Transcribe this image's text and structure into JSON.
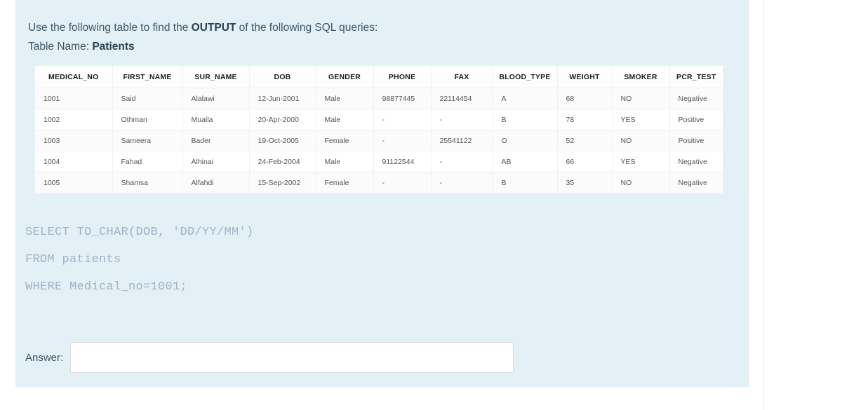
{
  "prompt": {
    "line1_before": "Use the following table to find the ",
    "line1_bold": "OUTPUT",
    "line1_after": " of the following SQL queries:",
    "line2_before": "Table Name: ",
    "line2_bold": "Patients"
  },
  "table": {
    "name": "Patients",
    "columns": [
      "MEDICAL_NO",
      "FIRST_NAME",
      "SUR_NAME",
      "DOB",
      "GENDER",
      "PHONE",
      "FAX",
      "BLOOD_TYPE",
      "WEIGHT",
      "SMOKER",
      "PCR_TEST"
    ],
    "rows": [
      [
        "1001",
        "Said",
        "Alalawi",
        "12-Jun-2001",
        "Male",
        "98877445",
        "22114454",
        "A",
        "68",
        "NO",
        "Negative"
      ],
      [
        "1002",
        "Othman",
        "Mualla",
        "20-Apr-2000",
        "Male",
        "-",
        "-",
        "B",
        "78",
        "YES",
        "Positive"
      ],
      [
        "1003",
        "Sameera",
        "Bader",
        "19-Oct-2005",
        "Female",
        "-",
        "25541122",
        "O",
        "52",
        "NO",
        "Positive"
      ],
      [
        "1004",
        "Fahad",
        "Alhinai",
        "24-Feb-2004",
        "Male",
        "91122544",
        "-",
        "AB",
        "66",
        "YES",
        "Negative"
      ],
      [
        "1005",
        "Shamsa",
        "Alfahdi",
        "15-Sep-2002",
        "Female",
        "-",
        "-",
        "B",
        "35",
        "NO",
        "Negative"
      ]
    ]
  },
  "sql": {
    "lines": [
      "SELECT TO_CHAR(DOB, 'DD/YY/MM')",
      "FROM patients",
      "WHERE Medical_no=1001;"
    ]
  },
  "answer": {
    "label": "Answer:",
    "value": "",
    "placeholder": ""
  },
  "colors": {
    "panel_background": "#e3f1f7",
    "prompt_text": "#3f5662",
    "sql_text": "#9fb3c4",
    "table_background": "#ffffff",
    "row_stripe": "#fbfbfb"
  }
}
